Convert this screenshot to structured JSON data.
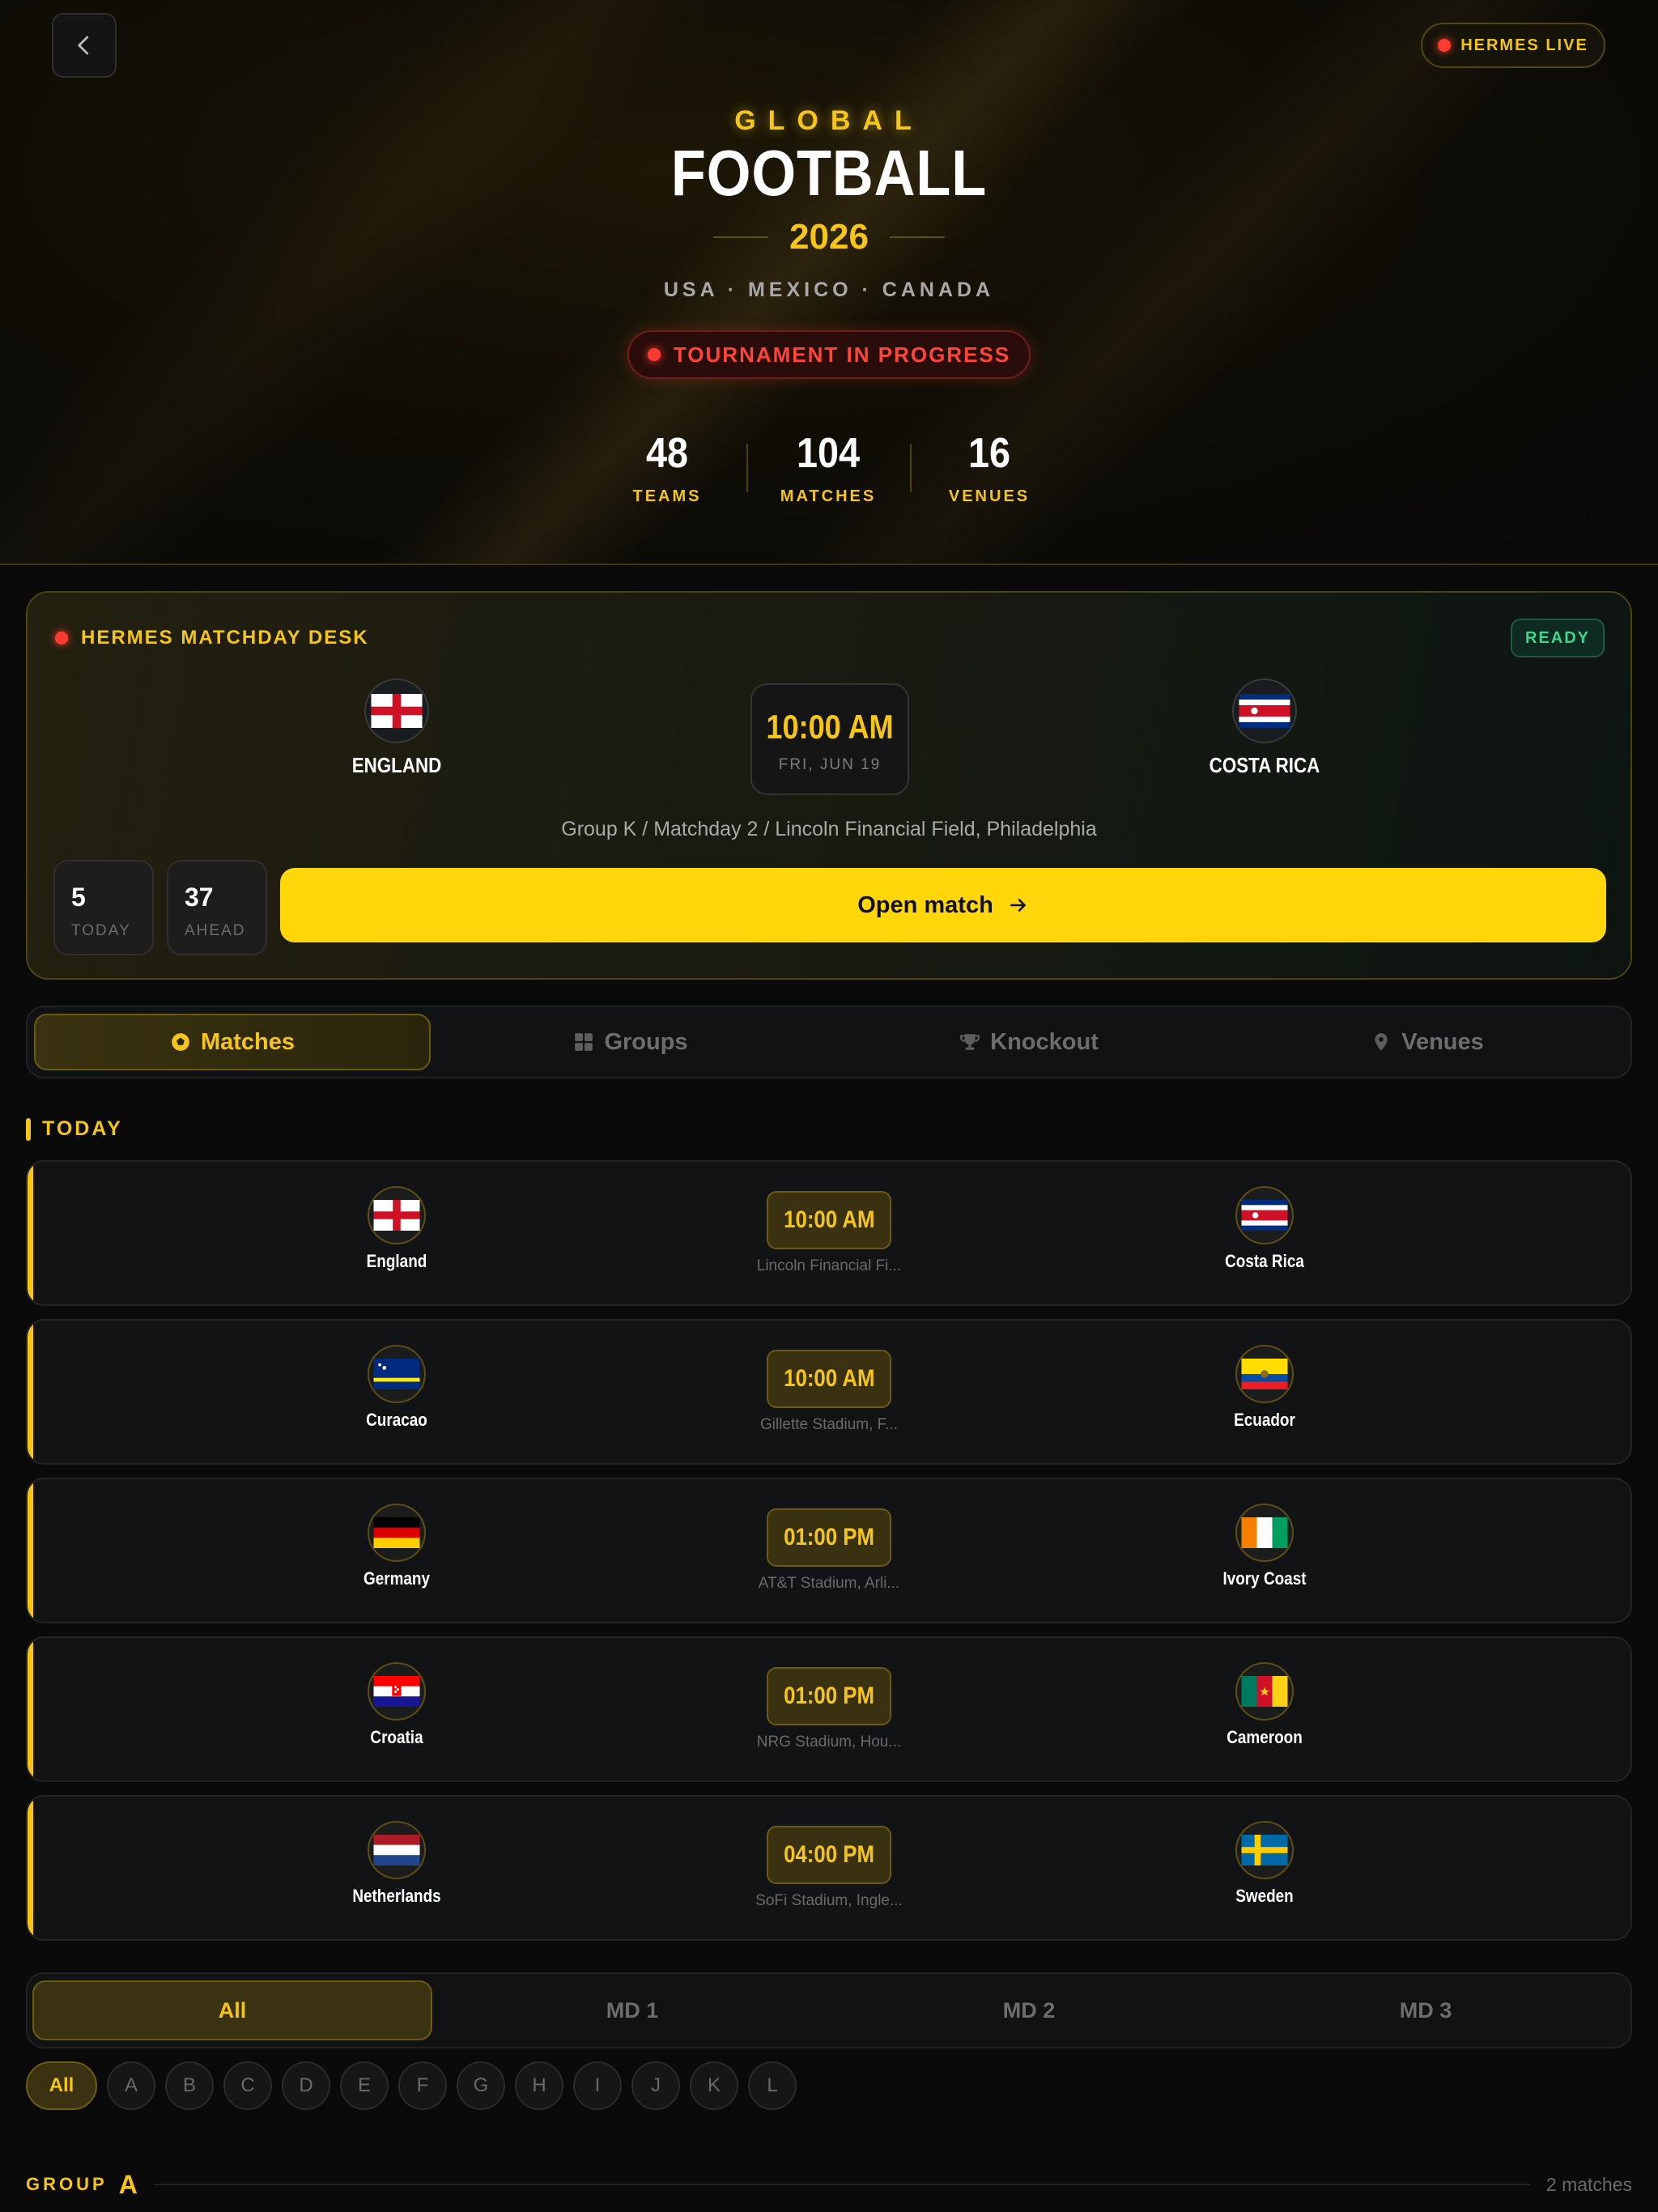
{
  "header": {
    "live_label": "HERMES LIVE",
    "brand_top": "GLOBAL",
    "brand_main": "FOOTBALL",
    "year": "2026",
    "hosts": "USA · MEXICO · CANADA",
    "status": "TOURNAMENT IN PROGRESS",
    "stats": [
      {
        "value": "48",
        "label": "TEAMS"
      },
      {
        "value": "104",
        "label": "MATCHES"
      },
      {
        "value": "16",
        "label": "VENUES"
      }
    ]
  },
  "desk": {
    "title": "HERMES MATCHDAY DESK",
    "status": "READY",
    "home": "ENGLAND",
    "away": "COSTA RICA",
    "time": "10:00 AM",
    "date": "FRI, JUN 19",
    "detail": "Group K / Matchday 2 / Lincoln Financial Field, Philadelphia",
    "today_count": "5",
    "today_label": "TODAY",
    "ahead_count": "37",
    "ahead_label": "AHEAD",
    "cta": "Open match"
  },
  "tabs": [
    "Matches",
    "Groups",
    "Knockout",
    "Venues"
  ],
  "today": {
    "title": "TODAY",
    "matches": [
      {
        "home": "England",
        "away": "Costa Rica",
        "time": "10:00 AM",
        "venue": "Lincoln Financial Fi..."
      },
      {
        "home": "Curacao",
        "away": "Ecuador",
        "time": "10:00 AM",
        "venue": "Gillette Stadium, F..."
      },
      {
        "home": "Germany",
        "away": "Ivory Coast",
        "time": "01:00 PM",
        "venue": "AT&T Stadium, Arli..."
      },
      {
        "home": "Croatia",
        "away": "Cameroon",
        "time": "01:00 PM",
        "venue": "NRG Stadium, Hou..."
      },
      {
        "home": "Netherlands",
        "away": "Sweden",
        "time": "04:00 PM",
        "venue": "SoFi Stadium, Ingle..."
      }
    ]
  },
  "matchdays": [
    "All",
    "MD 1",
    "MD 2",
    "MD 3"
  ],
  "groups": [
    "All",
    "A",
    "B",
    "C",
    "D",
    "E",
    "F",
    "G",
    "H",
    "I",
    "J",
    "K",
    "L"
  ],
  "group_section": {
    "label": "GROUP",
    "letter": "A",
    "count": "2 matches"
  },
  "colors": {
    "accent": "#f5c518",
    "live": "#ff3b30",
    "ready": "#3dd68c",
    "cta": "#ffd60a"
  }
}
